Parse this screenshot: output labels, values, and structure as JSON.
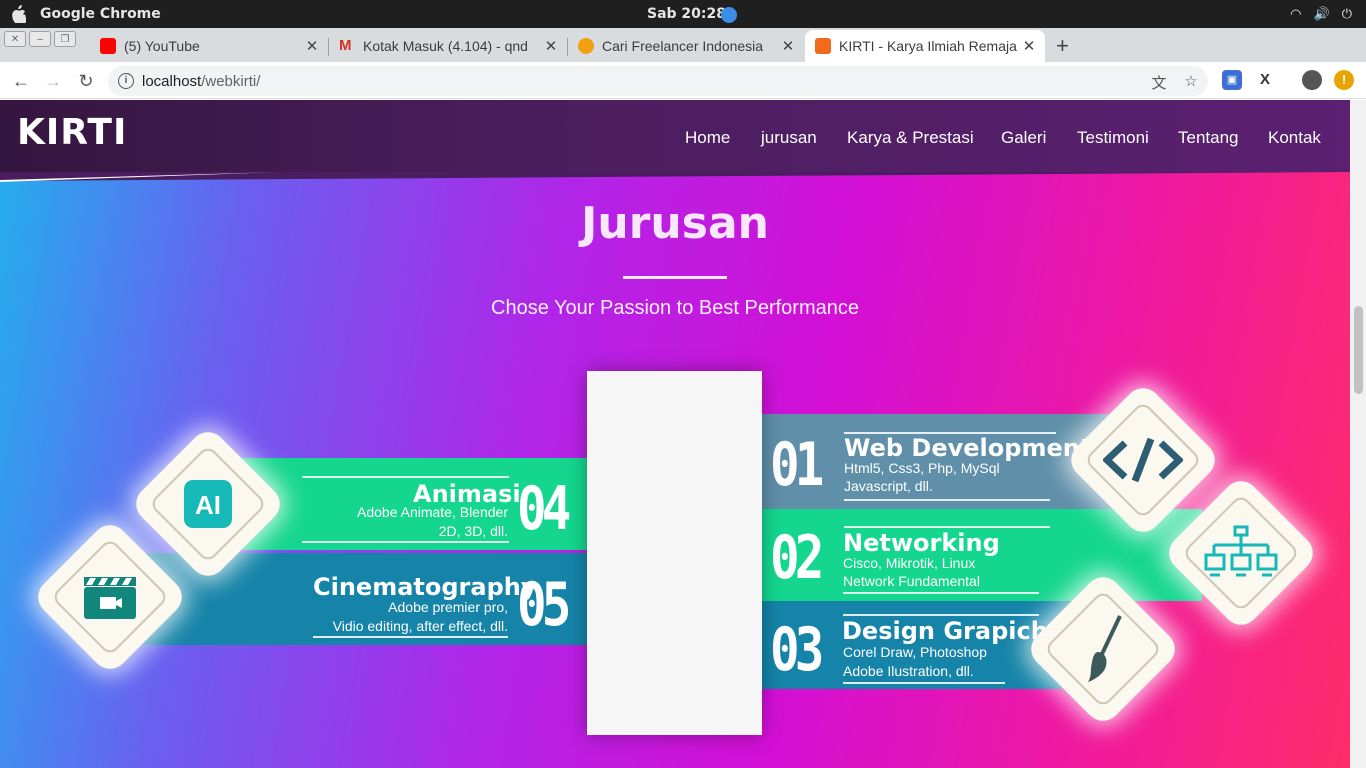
{
  "os": {
    "app_name": "Google Chrome",
    "clock": "Sab 20:28"
  },
  "tabs": [
    {
      "title": "(5) YouTube",
      "favicon": "youtube-icon",
      "color": "#ff0000"
    },
    {
      "title": "Kotak Masuk (4.104) - qnd",
      "favicon": "gmail-icon",
      "color": "#d93025"
    },
    {
      "title": "Cari Freelancer Indonesia",
      "favicon": "freelancer-icon",
      "color": "#f0a010"
    },
    {
      "title": "KIRTI - Karya Ilmiah Remaja",
      "favicon": "xampp-icon",
      "color": "#f26a1b"
    }
  ],
  "address": {
    "host": "localhost",
    "path": "/webkirti/"
  },
  "site": {
    "brand": "KIRTI",
    "menu": [
      "Home",
      "jurusan",
      "Karya & Prestasi",
      "Galeri",
      "Testimoni",
      "Tentang",
      "Kontak"
    ]
  },
  "section": {
    "title": "Jurusan",
    "subtitle": "Chose Your Passion to Best Performance"
  },
  "majors": [
    {
      "num": "01",
      "title": "Web Development",
      "line1": "Html5, Css3, Php, MySql",
      "line2": "Javascript, dll.",
      "icon": "code-icon"
    },
    {
      "num": "02",
      "title": "Networking",
      "line1": "Cisco, Mikrotik, Linux",
      "line2": "Network Fundamental",
      "icon": "network-icon"
    },
    {
      "num": "03",
      "title": "Design Grapich",
      "line1": "Corel Draw, Photoshop",
      "line2": "Adobe Ilustration, dll.",
      "icon": "brush-icon"
    },
    {
      "num": "04",
      "title": "Animasi",
      "line1": "Adobe Animate, Blender",
      "line2": "2D, 3D, dll.",
      "icon": "ai-icon"
    },
    {
      "num": "05",
      "title": "Cinematography",
      "line1": "Adobe premier pro,",
      "line2": "Vidio editing, after effect, dll.",
      "icon": "clapperboard-icon"
    }
  ],
  "colors": {
    "band_green": "#14d68f",
    "band_blue": "#1584a8",
    "band_slate": "#5f8fa9",
    "icon_teal": "#16b8b8",
    "icon_navy": "#2c5d73"
  }
}
